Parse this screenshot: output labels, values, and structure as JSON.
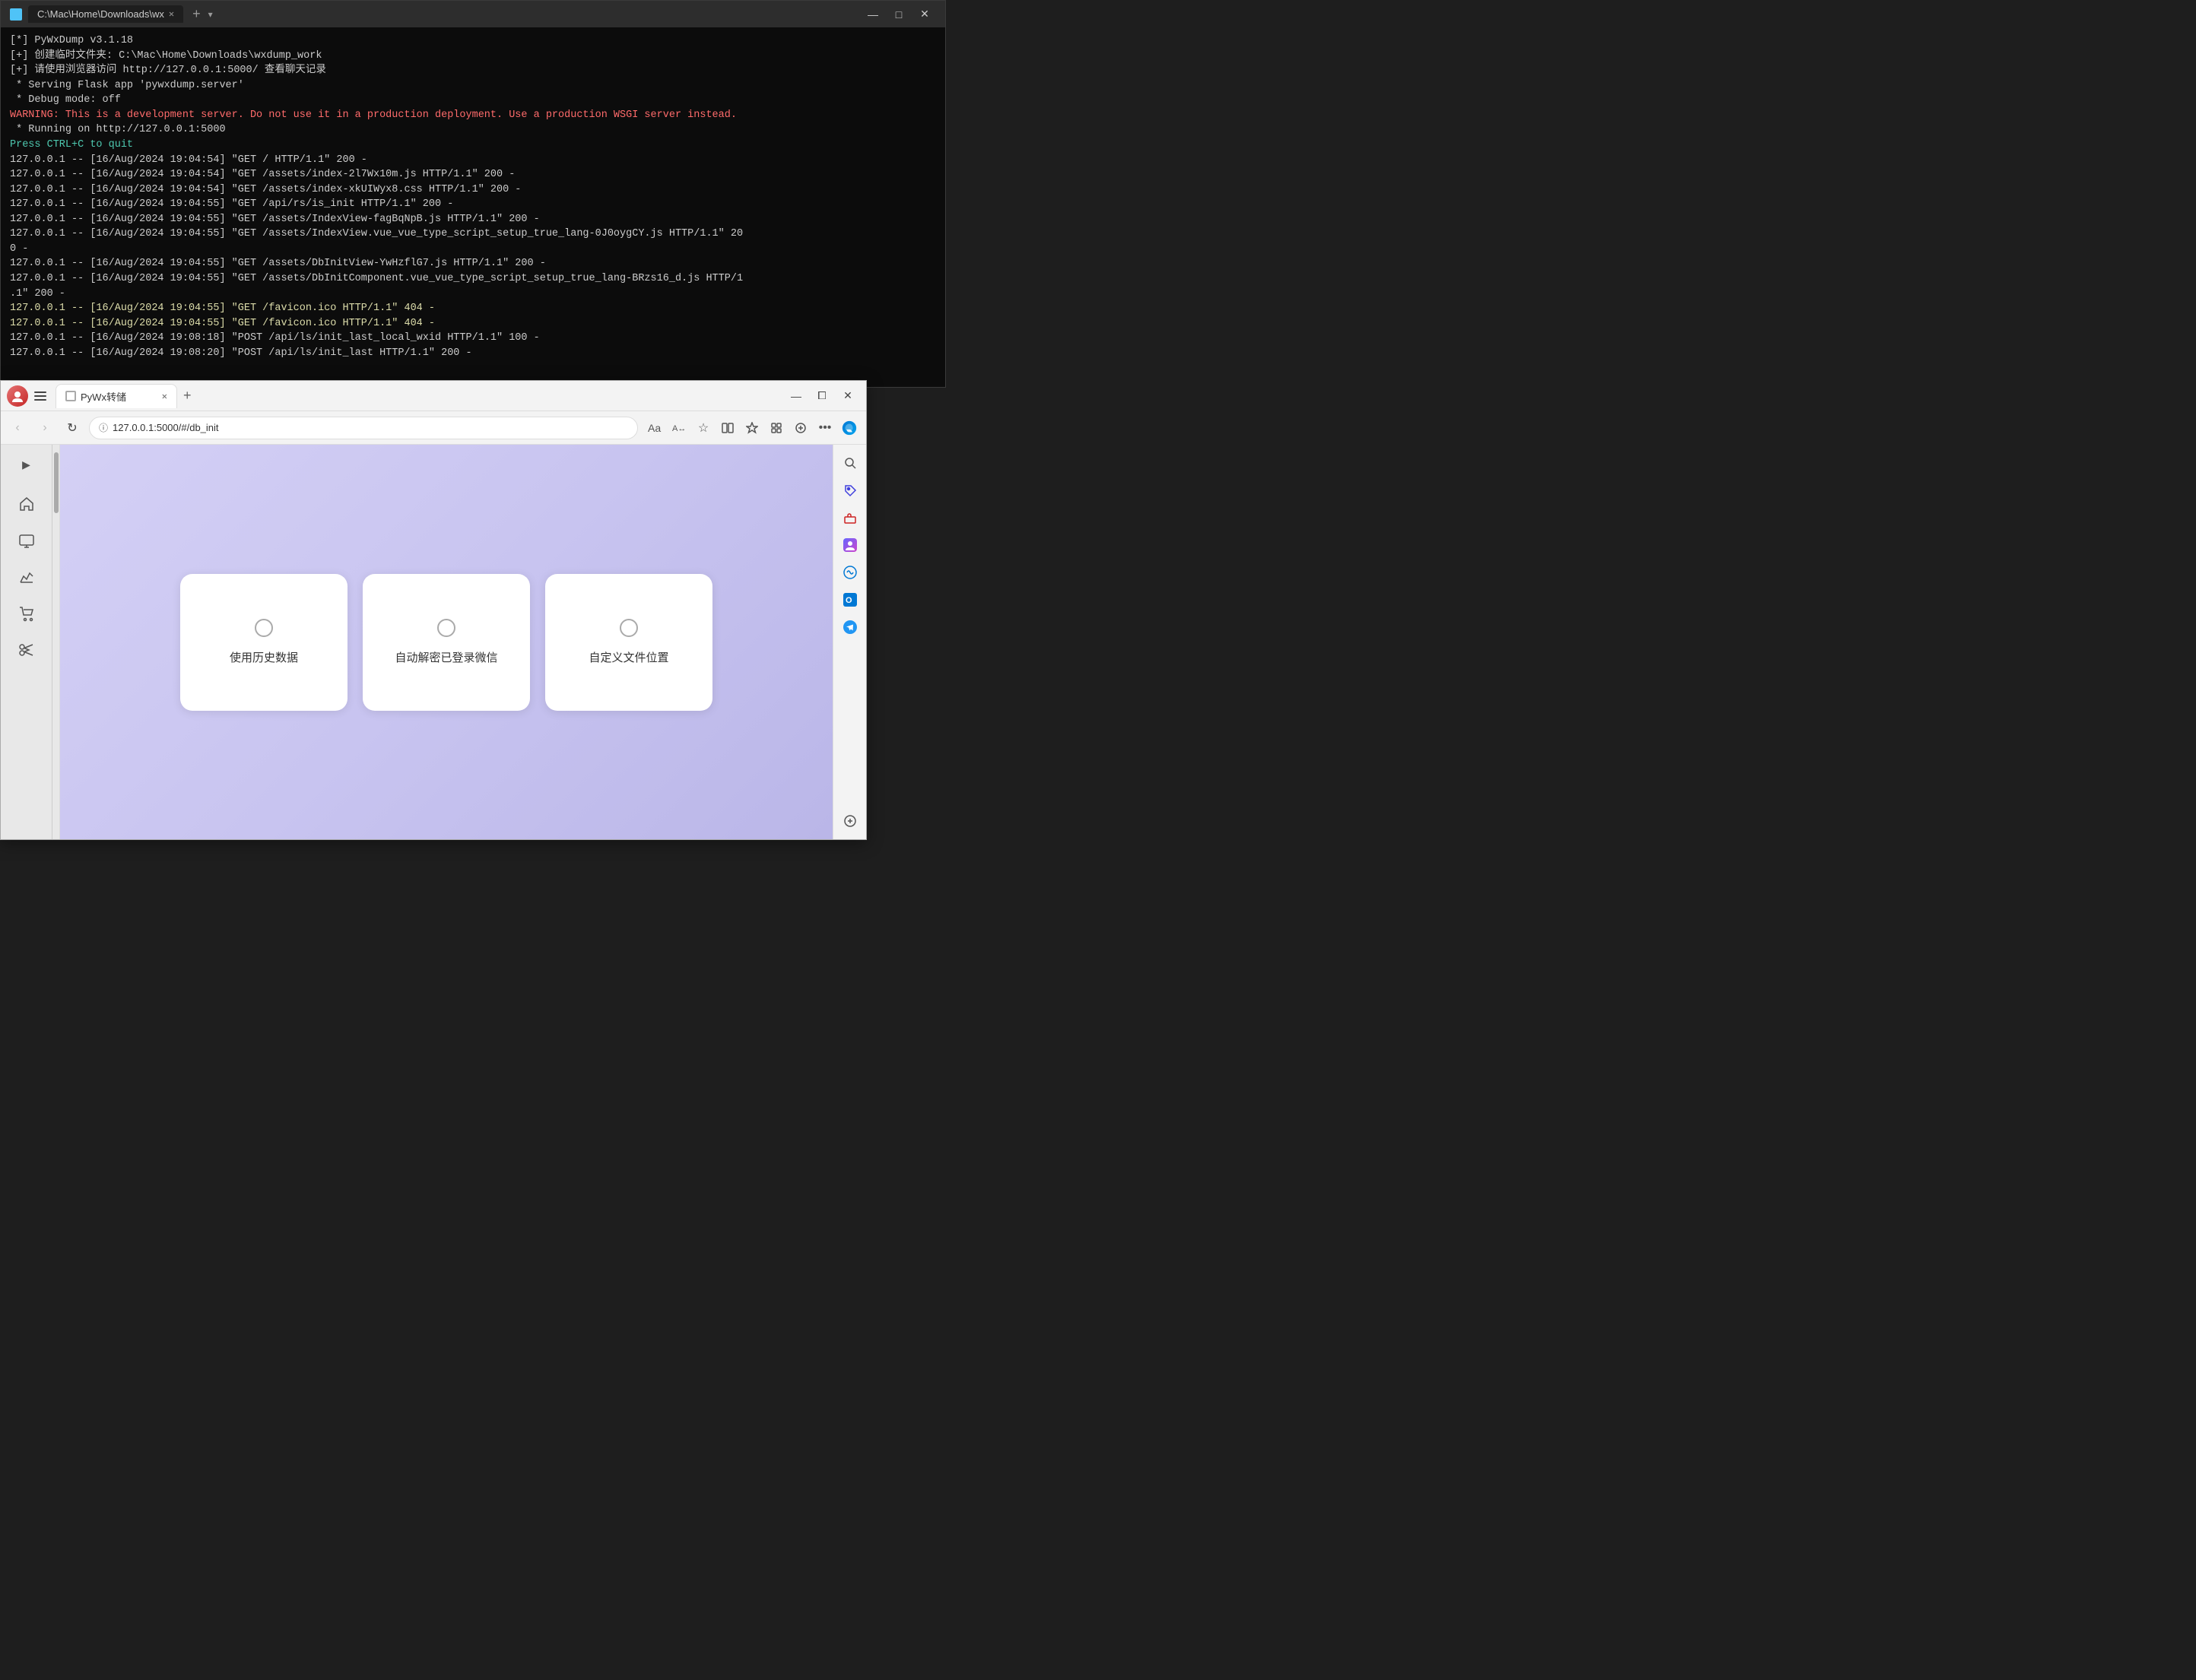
{
  "terminal": {
    "title": "C:\\Mac\\Home\\Downloads\\wx",
    "lines": [
      {
        "text": "[*] PyWxDump v3.1.18",
        "class": ""
      },
      {
        "text": "[+] 创建临时文件夹: C:\\Mac\\Home\\Downloads\\wxdump_work",
        "class": ""
      },
      {
        "text": "[+] 请使用浏览器访问 http://127.0.0.1:5000/ 查看聊天记录",
        "class": ""
      },
      {
        "text": " * Serving Flask app 'pywxdump.server'",
        "class": ""
      },
      {
        "text": " * Debug mode: off",
        "class": ""
      },
      {
        "text": "WARNING: This is a development server. Do not use it in a production deployment. Use a production WSGI server instead.",
        "class": "warning"
      },
      {
        "text": " * Running on http://127.0.0.1:5000",
        "class": ""
      },
      {
        "text": "Press CTRL+C to quit",
        "class": "press-ctrl"
      },
      {
        "text": "127.0.0.1 -- [16/Aug/2024 19:04:54] \"GET / HTTP/1.1\" 200 -",
        "class": ""
      },
      {
        "text": "127.0.0.1 -- [16/Aug/2024 19:04:54] \"GET /assets/index-2l7Wx10m.js HTTP/1.1\" 200 -",
        "class": ""
      },
      {
        "text": "127.0.0.1 -- [16/Aug/2024 19:04:54] \"GET /assets/index-xkUIWyx8.css HTTP/1.1\" 200 -",
        "class": ""
      },
      {
        "text": "127.0.0.1 -- [16/Aug/2024 19:04:55] \"GET /api/rs/is_init HTTP/1.1\" 200 -",
        "class": ""
      },
      {
        "text": "127.0.0.1 -- [16/Aug/2024 19:04:55] \"GET /assets/IndexView-fagBqNpB.js HTTP/1.1\" 200 -",
        "class": ""
      },
      {
        "text": "127.0.0.1 -- [16/Aug/2024 19:04:55] \"GET /assets/IndexView.vue_vue_type_script_setup_true_lang-0J0oygCY.js HTTP/1.1\" 20",
        "class": ""
      },
      {
        "text": "0 -",
        "class": ""
      },
      {
        "text": "127.0.0.1 -- [16/Aug/2024 19:04:55] \"GET /assets/DbInitView-YwHzflG7.js HTTP/1.1\" 200 -",
        "class": ""
      },
      {
        "text": "127.0.0.1 -- [16/Aug/2024 19:04:55] \"GET /assets/DbInitComponent.vue_vue_type_script_setup_true_lang-BRzs16_d.js HTTP/1",
        "class": ""
      },
      {
        "text": ".1\" 200 -",
        "class": ""
      },
      {
        "text": "127.0.0.1 -- [16/Aug/2024 19:04:55] \"GET /favicon.ico HTTP/1.1\" 404 -",
        "class": "yellow"
      },
      {
        "text": "127.0.0.1 -- [16/Aug/2024 19:04:55] \"GET /favicon.ico HTTP/1.1\" 404 -",
        "class": "yellow"
      },
      {
        "text": "127.0.0.1 -- [16/Aug/2024 19:08:18] \"POST /api/ls/init_last_local_wxid HTTP/1.1\" 100 -",
        "class": ""
      },
      {
        "text": "127.0.0.1 -- [16/Aug/2024 19:08:20] \"POST /api/ls/init_last HTTP/1.1\" 200 -",
        "class": ""
      }
    ]
  },
  "browser": {
    "tab_title": "PyWx转储",
    "url": "127.0.0.1:5000/#/db_init",
    "cards": [
      {
        "label": "使用历史数据",
        "id": "card-history"
      },
      {
        "label": "自动解密已登录微信",
        "id": "card-auto"
      },
      {
        "label": "自定义文件位置",
        "id": "card-custom"
      }
    ],
    "sidebar_items": [
      {
        "icon": "▶",
        "name": "expand"
      },
      {
        "icon": "⌂",
        "name": "home"
      },
      {
        "icon": "☰",
        "name": "collections"
      },
      {
        "icon": "↗",
        "name": "chart"
      },
      {
        "icon": "🛒",
        "name": "shop"
      },
      {
        "icon": "✂",
        "name": "tools"
      }
    ],
    "right_sidebar_buttons": [
      {
        "icon": "🔍",
        "name": "search"
      },
      {
        "icon": "🏷",
        "name": "tag"
      },
      {
        "icon": "🧰",
        "name": "toolbox"
      },
      {
        "icon": "👤",
        "name": "profile"
      },
      {
        "icon": "🔵",
        "name": "circle"
      },
      {
        "icon": "📧",
        "name": "mail"
      },
      {
        "icon": "✈",
        "name": "send"
      },
      {
        "icon": "+",
        "name": "add"
      }
    ]
  },
  "controls": {
    "minimize": "—",
    "maximize": "□",
    "close": "✕"
  }
}
